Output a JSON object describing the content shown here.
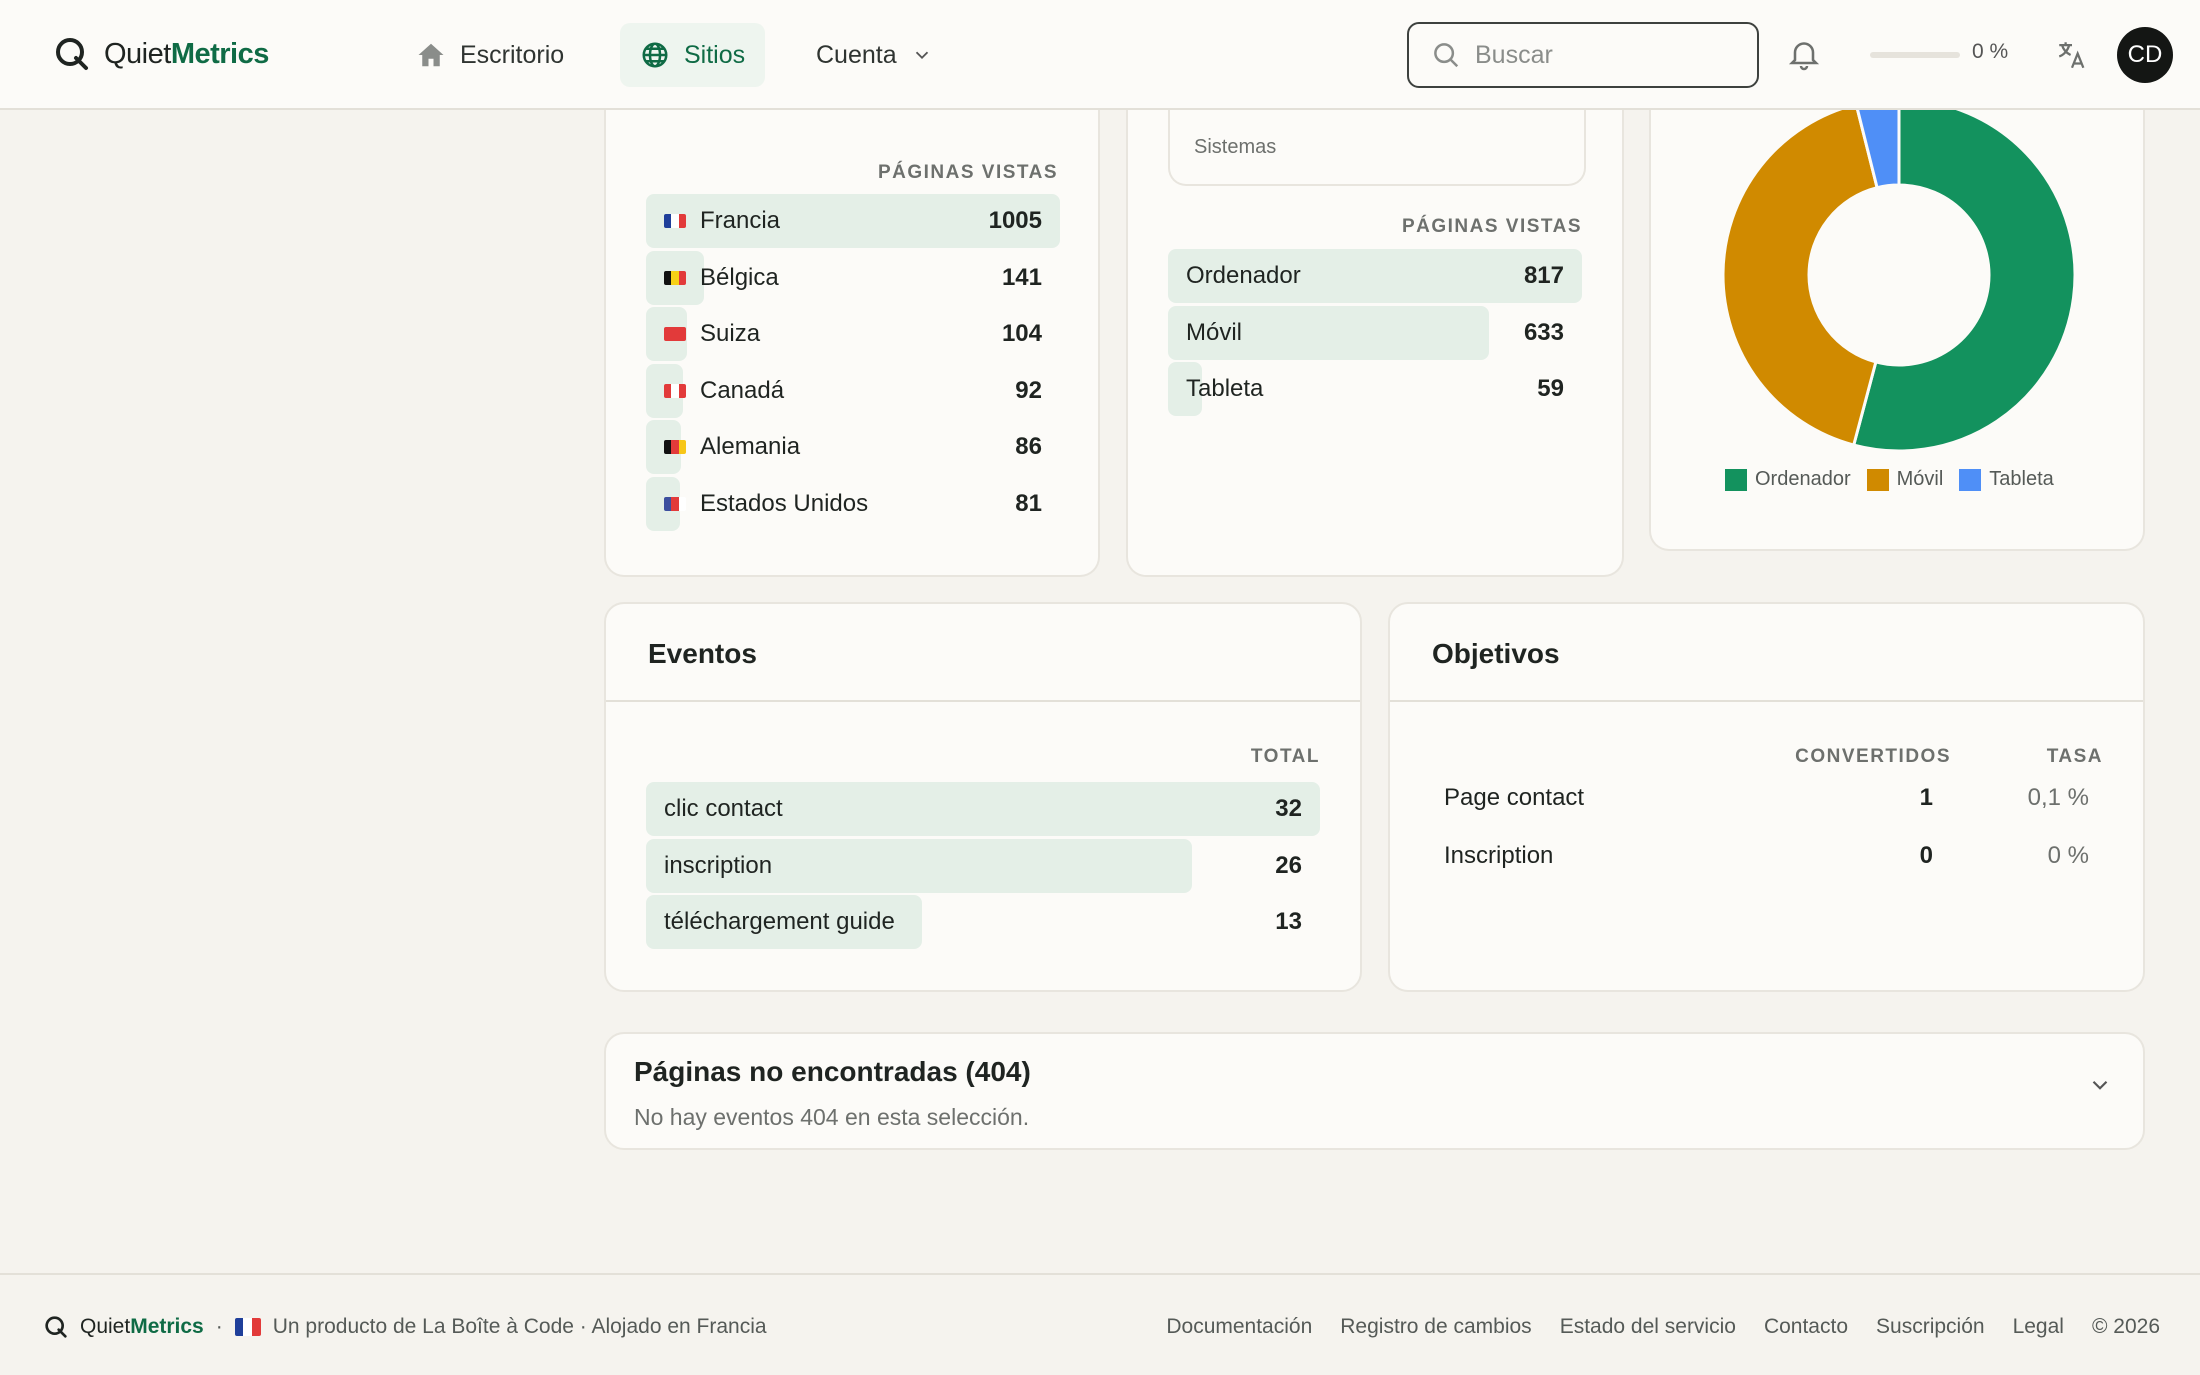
{
  "brand": {
    "name_light": "Quiet",
    "name_bold": "Metrics"
  },
  "nav": {
    "dashboard": "Escritorio",
    "sites": "Sitios",
    "account": "Cuenta"
  },
  "search": {
    "placeholder": "Buscar"
  },
  "progress": {
    "percent": 0,
    "text": "0 %"
  },
  "avatar": {
    "initials": "CD"
  },
  "countries": {
    "column_header": "PÁGINAS VISTAS",
    "rows": [
      {
        "label": "Francia",
        "value": "1005",
        "share": 1.0,
        "flag": [
          "#1f3f9a",
          "#ffffff",
          "#e23a3a"
        ],
        "flag_icon": "france-flag-icon"
      },
      {
        "label": "Bélgica",
        "value": "141",
        "share": 0.14,
        "flag": [
          "#111111",
          "#f7d117",
          "#e23a3a"
        ],
        "flag_icon": "belgium-flag-icon"
      },
      {
        "label": "Suiza",
        "value": "104",
        "share": 0.1,
        "flag": [
          "#e23a3a",
          "#e23a3a",
          "#e23a3a"
        ],
        "flag_icon": "switzerland-flag-icon"
      },
      {
        "label": "Canadá",
        "value": "92",
        "share": 0.09,
        "flag": [
          "#e23a3a",
          "#ffffff",
          "#e23a3a"
        ],
        "flag_icon": "canada-flag-icon"
      },
      {
        "label": "Alemania",
        "value": "86",
        "share": 0.085,
        "flag": [
          "#111111",
          "#e23a3a",
          "#f7c617"
        ],
        "flag_icon": "germany-flag-icon"
      },
      {
        "label": "Estados Unidos",
        "value": "81",
        "share": 0.08,
        "flag": [
          "#3c4f9e",
          "#e23a3a",
          "#ffffff"
        ],
        "flag_icon": "usa-flag-icon"
      }
    ]
  },
  "devices": {
    "tab_label": "Sistemas",
    "column_header": "PÁGINAS VISTAS",
    "rows": [
      {
        "label": "Ordenador",
        "value": "817",
        "share": 1.0
      },
      {
        "label": "Móvil",
        "value": "633",
        "share": 0.775
      },
      {
        "label": "Tableta",
        "value": "59",
        "share": 0.07
      }
    ]
  },
  "chart_data": {
    "type": "pie",
    "labels": [
      "Ordenador",
      "Móvil",
      "Tableta"
    ],
    "values": [
      817,
      633,
      59
    ],
    "colors": [
      "#13925e",
      "#d08a00",
      "#4f8ff7"
    ],
    "legend_position": "bottom"
  },
  "events": {
    "title": "Eventos",
    "column_header": "TOTAL",
    "rows": [
      {
        "label": "clic contact",
        "value": "32",
        "share": 1.0
      },
      {
        "label": "inscription",
        "value": "26",
        "share": 0.81
      },
      {
        "label": "téléchargement guide",
        "value": "13",
        "share": 0.41
      }
    ]
  },
  "goals": {
    "title": "Objetivos",
    "col_converted": "CONVERTIDOS",
    "col_rate": "TASA",
    "rows": [
      {
        "label": "Page contact",
        "converted": "1",
        "rate": "0,1 %"
      },
      {
        "label": "Inscription",
        "converted": "0",
        "rate": "0 %"
      }
    ]
  },
  "not_found": {
    "title": "Páginas no encontradas (404)",
    "message": "No hay eventos 404 en esta selección."
  },
  "footer": {
    "brand_light": "Quiet",
    "brand_bold": "Metrics",
    "separator": "·",
    "tagline": "Un producto de La Boîte à Code · Alojado en Francia",
    "links": [
      "Documentación",
      "Registro de cambios",
      "Estado del servicio",
      "Contacto",
      "Suscripción",
      "Legal"
    ],
    "copyright": "© 2026"
  },
  "colors": {
    "accent": "#0f6b45",
    "bar_fill": "#e4efe7"
  }
}
